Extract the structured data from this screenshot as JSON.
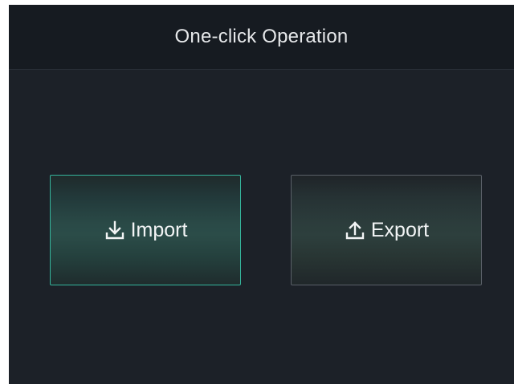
{
  "header": {
    "title": "One-click Operation"
  },
  "actions": {
    "import": {
      "label": "Import",
      "icon": "import-download-icon",
      "accent_color": "#35b59c"
    },
    "export": {
      "label": "Export",
      "icon": "export-upload-icon"
    }
  }
}
